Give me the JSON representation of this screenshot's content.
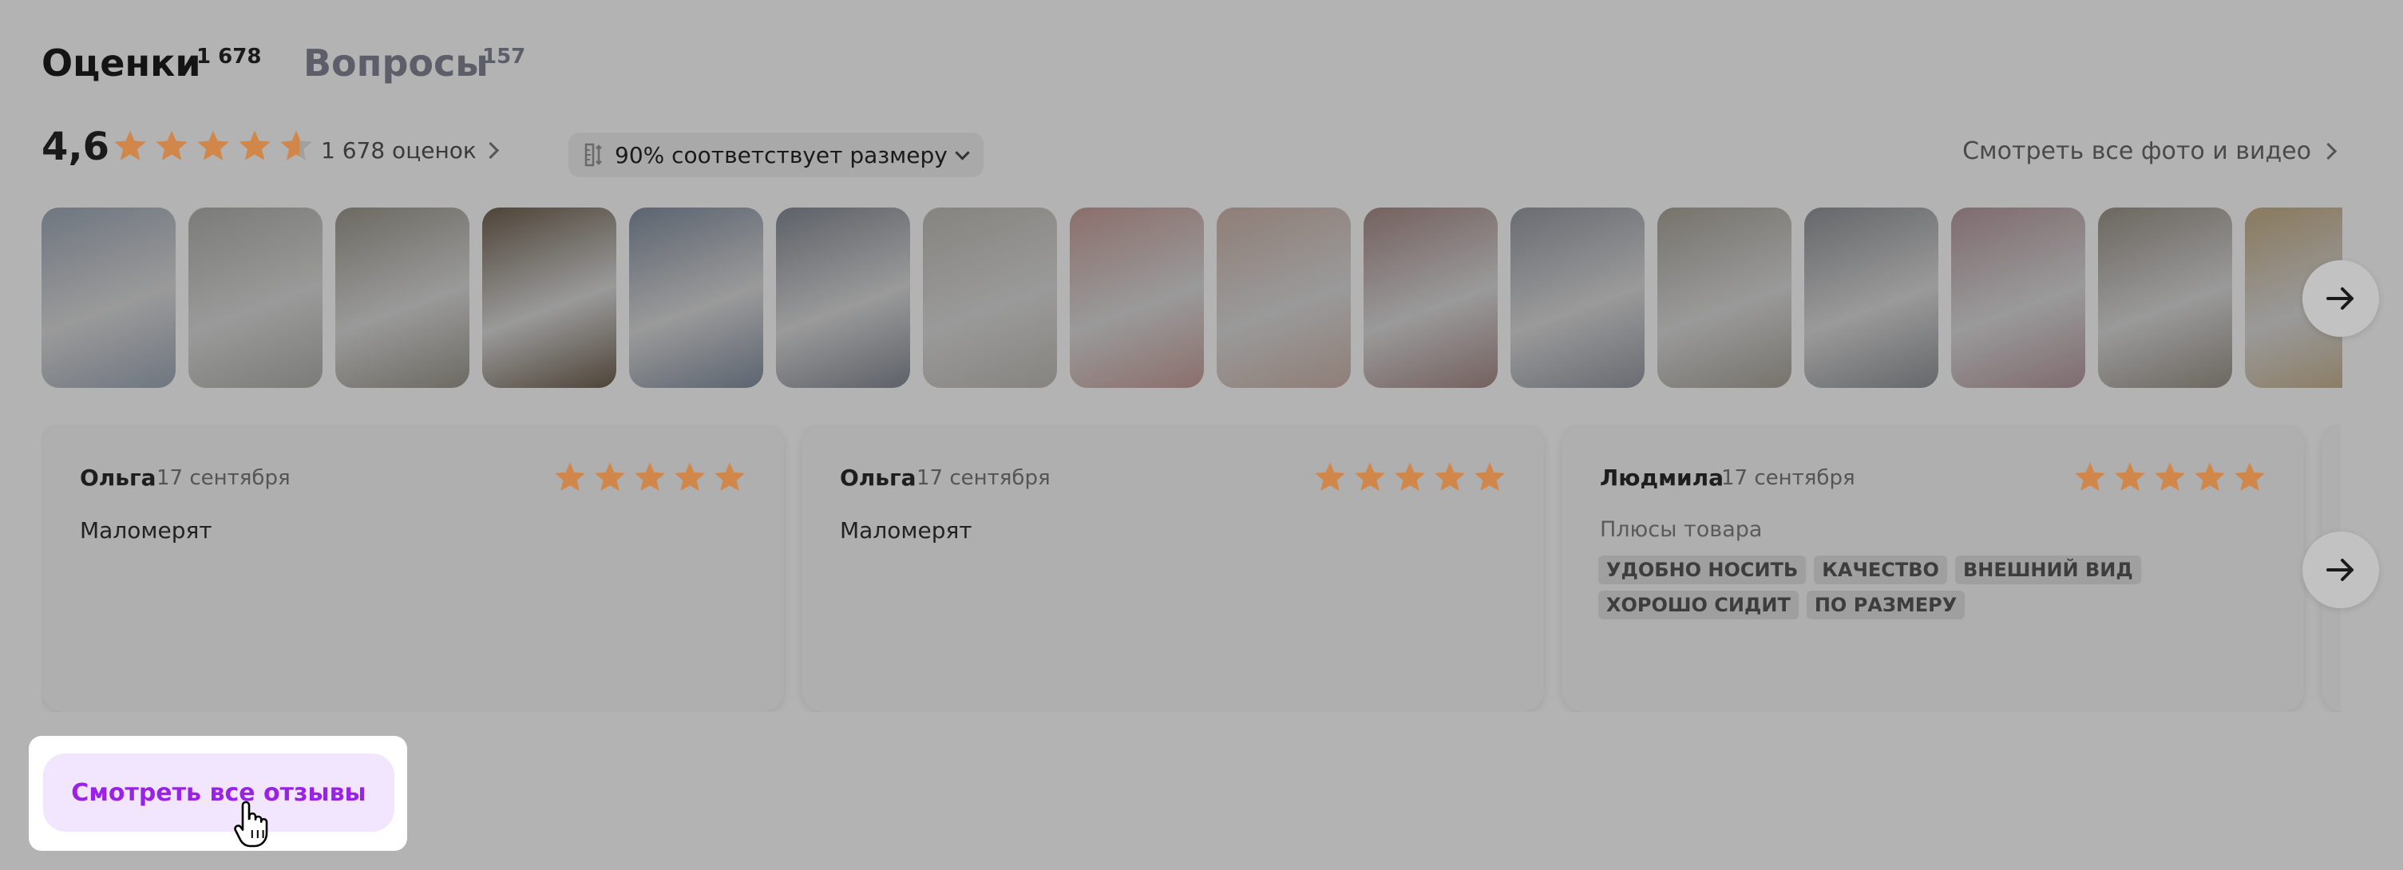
{
  "tabs": [
    {
      "label": "Оценки",
      "count": "1 678",
      "active": true
    },
    {
      "label": "Вопросы",
      "count": "157",
      "active": false
    }
  ],
  "summary": {
    "rating": "4,6",
    "rating_value": 4.6,
    "stars_max": 5,
    "reviews_link": "1 678 оценок",
    "size_fit": "90% соответствует размеру",
    "all_photos": "Смотреть все фото и видео"
  },
  "photos": [
    {
      "icon": "photo-thumbnail",
      "color": "#6f7680"
    },
    {
      "icon": "photo-thumbnail",
      "color": "#7b7b78"
    },
    {
      "icon": "photo-thumbnail",
      "color": "#6c6a62"
    },
    {
      "icon": "photo-thumbnail",
      "color": "#4e4438"
    },
    {
      "icon": "photo-thumbnail",
      "color": "#5c6470"
    },
    {
      "icon": "photo-thumbnail",
      "color": "#5d6168"
    },
    {
      "icon": "photo-thumbnail",
      "color": "#86847f"
    },
    {
      "icon": "photo-thumbnail",
      "color": "#8b6f6c"
    },
    {
      "icon": "photo-thumbnail",
      "color": "#8f7e77"
    },
    {
      "icon": "photo-thumbnail",
      "color": "#74615f"
    },
    {
      "icon": "photo-thumbnail",
      "color": "#6a6c73"
    },
    {
      "icon": "photo-thumbnail",
      "color": "#76736c"
    },
    {
      "icon": "photo-thumbnail",
      "color": "#66676a"
    },
    {
      "icon": "photo-thumbnail",
      "color": "#7f6b70"
    },
    {
      "icon": "photo-thumbnail",
      "color": "#6c6760"
    },
    {
      "icon": "photo-thumbnail",
      "color": "#8a7a5e"
    }
  ],
  "reviews": [
    {
      "author": "Ольга",
      "date": "17 сентября",
      "rating": 5,
      "text": "Маломерят"
    },
    {
      "author": "Ольга",
      "date": "17 сентября",
      "rating": 5,
      "text": "Маломерят"
    },
    {
      "author": "Людмила",
      "date": "17 сентября",
      "rating": 5,
      "pros_label": "Плюсы товара",
      "tags": [
        "УДОБНО НОСИТЬ",
        "КАЧЕСТВО",
        "ВНЕШНИЙ ВИД",
        "ХОРОШО СИДИТ",
        "ПО РАЗМЕРУ"
      ]
    }
  ],
  "buttons": {
    "all_reviews": "Смотреть все отзывы"
  },
  "icons": {
    "next": "arrow-right-icon",
    "star": "star-icon",
    "cursor": "hand-cursor-icon",
    "size": "ruler-icon"
  },
  "colors": {
    "star": "#d2874a",
    "button_text": "#9a22e6",
    "button_bg": "#f1e6fd",
    "page_overlay": "#b3b3b3"
  }
}
